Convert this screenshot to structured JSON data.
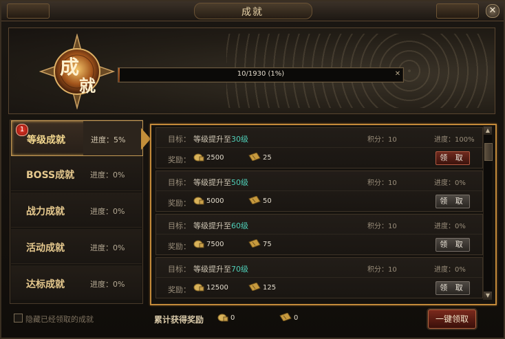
{
  "window": {
    "title": "成就",
    "close_glyph": "✕"
  },
  "banner": {
    "emblem_text": "成就",
    "progress_text": "10/1930 (1%)",
    "progress_fraction": 0.0052
  },
  "categories": [
    {
      "name": "等级成就",
      "progress": "进度：5%",
      "active": true,
      "badge": "1"
    },
    {
      "name": "BOSS成就",
      "progress": "进度：0%"
    },
    {
      "name": "战力成就",
      "progress": "进度：0%"
    },
    {
      "name": "活动成就",
      "progress": "进度：0%"
    },
    {
      "name": "达标成就",
      "progress": "进度：0%"
    }
  ],
  "labels": {
    "goal": "目标：",
    "reward": "奖励：",
    "claim": "领 取"
  },
  "achievements": [
    {
      "goal_prefix": "等级提升至",
      "goal_level": "30级",
      "points": "积分：10",
      "progress": "进度：100%",
      "coin": "2500",
      "ticket": "25",
      "claimable": true
    },
    {
      "goal_prefix": "等级提升至",
      "goal_level": "50级",
      "points": "积分：10",
      "progress": "进度：0%",
      "coin": "5000",
      "ticket": "50",
      "claimable": false
    },
    {
      "goal_prefix": "等级提升至",
      "goal_level": "60级",
      "points": "积分：10",
      "progress": "进度：0%",
      "coin": "7500",
      "ticket": "75",
      "claimable": false
    },
    {
      "goal_prefix": "等级提升至",
      "goal_level": "70级",
      "points": "积分：10",
      "progress": "进度：0%",
      "coin": "12500",
      "ticket": "125",
      "claimable": false
    }
  ],
  "scroll": {
    "up": "▲",
    "down": "▼"
  },
  "footer": {
    "hide_claimed": "隐藏已经领取的成就",
    "total_label": "累计获得奖励",
    "total_coin": "0",
    "total_ticket": "0",
    "one_click": "一键领取"
  }
}
